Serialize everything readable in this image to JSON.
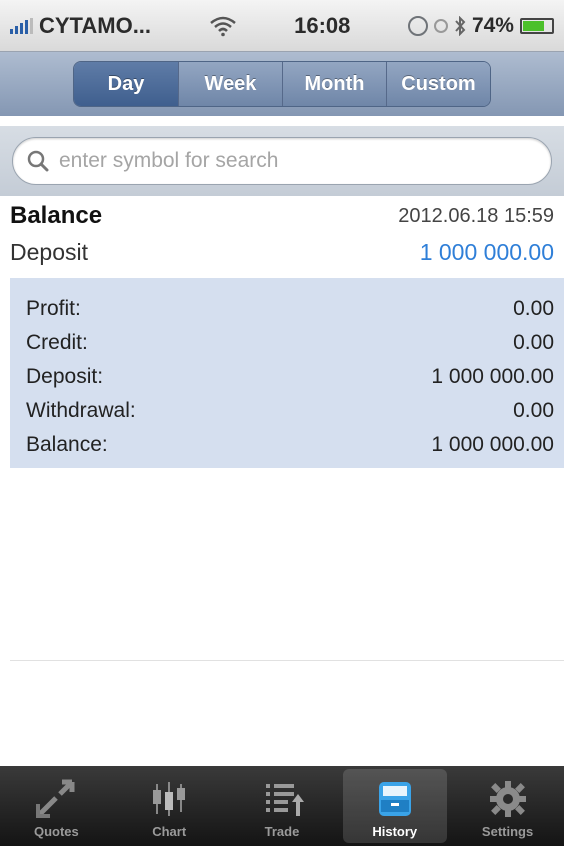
{
  "status": {
    "carrier": "CYTAMO...",
    "time": "16:08",
    "battery": "74%",
    "battery_level": 0.74
  },
  "segments": [
    {
      "label": "Day",
      "active": true
    },
    {
      "label": "Week",
      "active": false
    },
    {
      "label": "Month",
      "active": false
    },
    {
      "label": "Custom",
      "active": false
    }
  ],
  "search": {
    "placeholder": "enter symbol for search",
    "value": ""
  },
  "entry": {
    "title": "Balance",
    "date": "2012.06.18 15:59",
    "type": "Deposit",
    "amount": "1 000 000.00"
  },
  "summary": [
    {
      "label": "Profit:",
      "value": "0.00"
    },
    {
      "label": "Credit:",
      "value": "0.00"
    },
    {
      "label": "Deposit:",
      "value": "1 000 000.00"
    },
    {
      "label": "Withdrawal:",
      "value": "0.00"
    },
    {
      "label": "Balance:",
      "value": "1 000 000.00"
    }
  ],
  "tabs": [
    {
      "label": "Quotes",
      "icon": "quotes-icon",
      "active": false
    },
    {
      "label": "Chart",
      "icon": "chart-icon",
      "active": false
    },
    {
      "label": "Trade",
      "icon": "trade-icon",
      "active": false
    },
    {
      "label": "History",
      "icon": "history-icon",
      "active": true
    },
    {
      "label": "Settings",
      "icon": "gear-icon",
      "active": false
    }
  ],
  "colors": {
    "accent_blue": "#2f7fd8",
    "summary_bg": "#d5dfef",
    "segment_active": "#3f5f8e"
  }
}
